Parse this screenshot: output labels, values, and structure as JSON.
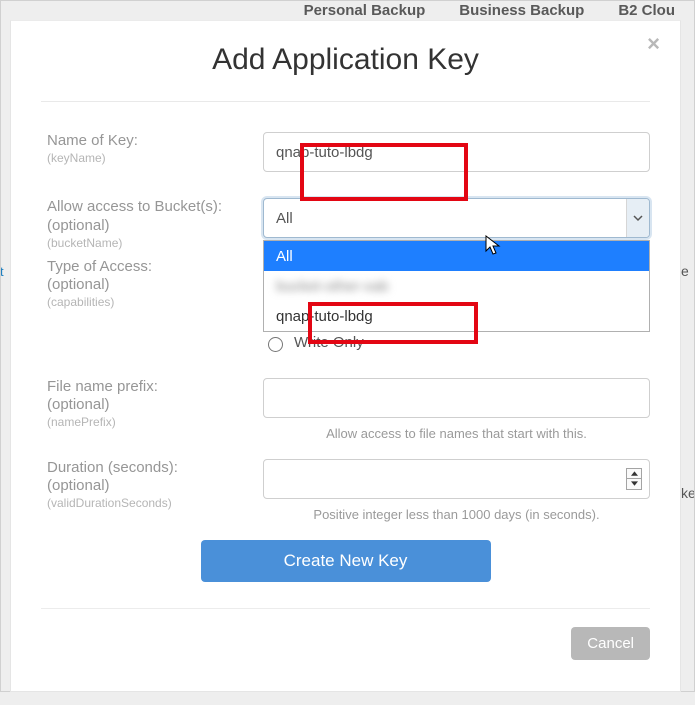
{
  "bg": {
    "nav1": "Personal Backup",
    "nav2": "Business Backup",
    "nav3": "B2 Clou",
    "left_letter": "t",
    "right1": "e",
    "right2": "ke"
  },
  "dialog": {
    "title": "Add Application Key"
  },
  "fields": {
    "keyName": {
      "label": "Name of Key:",
      "api": "(keyName)",
      "value": "qnap-tuto-lbdg"
    },
    "bucket": {
      "label": "Allow access to Bucket(s):",
      "sub": "(optional)",
      "api": "(bucketName)",
      "selected": "All",
      "options": {
        "opt_all": "All",
        "opt_blur": "bucket-other-xab",
        "opt_qnap": "qnap-tuto-lbdg"
      }
    },
    "access": {
      "label": "Type of Access:",
      "sub": "(optional)",
      "api": "(capabilities)",
      "radio_write": "Write Only"
    },
    "prefix": {
      "label": "File name prefix:",
      "sub": "(optional)",
      "api": "(namePrefix)",
      "helper": "Allow access to file names that start with this."
    },
    "duration": {
      "label": "Duration (seconds):",
      "sub": "(optional)",
      "api": "(validDurationSeconds)",
      "helper": "Positive integer less than 1000 days (in seconds)."
    }
  },
  "buttons": {
    "create": "Create New Key",
    "cancel": "Cancel"
  }
}
